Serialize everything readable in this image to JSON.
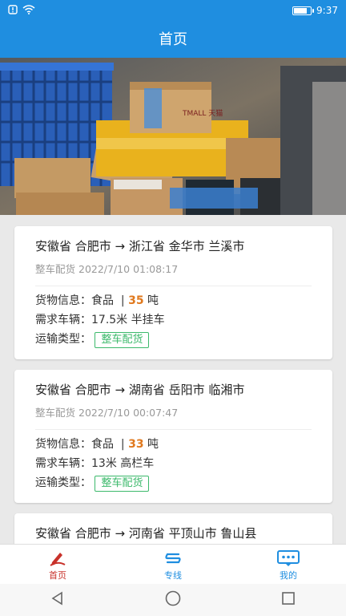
{
  "status_bar": {
    "time": "9:37"
  },
  "header": {
    "title": "首页"
  },
  "cards": [
    {
      "route": "安徽省 合肥市 → 浙江省 金华市 兰溪市",
      "meta_type": "整车配货",
      "meta_time": "2022/7/10 01:08:17",
      "goods_label": "货物信息：",
      "goods_name": "食品",
      "goods_sep": "|",
      "goods_qty": "35",
      "goods_unit": "吨",
      "vehicle_label": "需求车辆：",
      "vehicle_value": "17.5米 半挂车",
      "transport_label": "运输类型：",
      "transport_tag": "整车配货"
    },
    {
      "route": "安徽省 合肥市 → 湖南省 岳阳市 临湘市",
      "meta_type": "整车配货",
      "meta_time": "2022/7/10 00:07:47",
      "goods_label": "货物信息：",
      "goods_name": "食品",
      "goods_sep": "|",
      "goods_qty": "33",
      "goods_unit": "吨",
      "vehicle_label": "需求车辆：",
      "vehicle_value": "13米 高栏车",
      "transport_label": "运输类型：",
      "transport_tag": "整车配货"
    },
    {
      "route": "安徽省 合肥市 → 河南省 平顶山市 鲁山县"
    }
  ],
  "tabbar": {
    "home": "首页",
    "routes": "专线",
    "mine": "我的"
  },
  "banner": {
    "box_text": "TMALL 天猫"
  },
  "colors": {
    "primary": "#1f8ee0",
    "quantity": "#e0791e",
    "tag_green": "#3cb96b",
    "active_tab": "#c8312a"
  }
}
